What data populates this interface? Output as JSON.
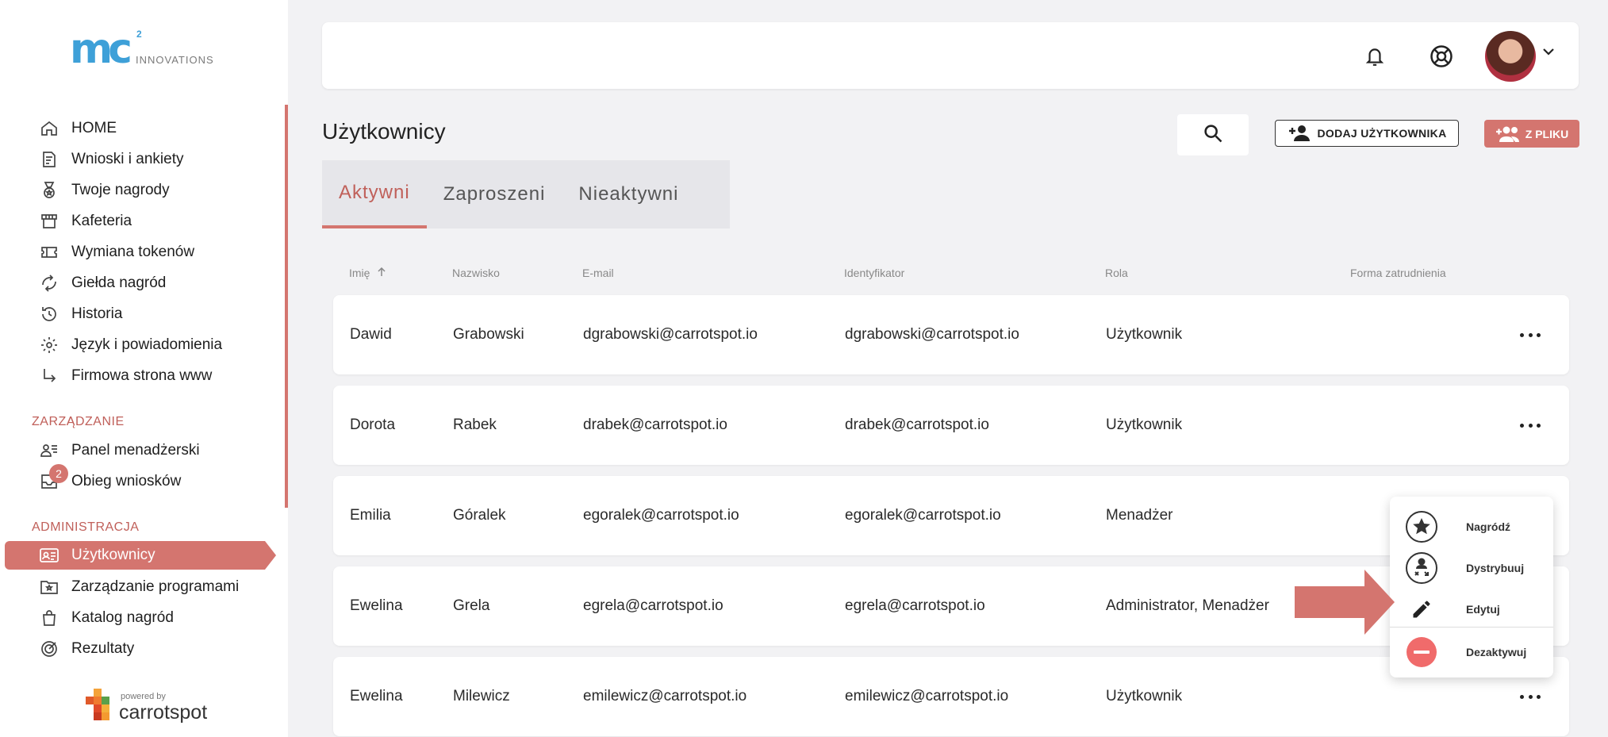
{
  "logo": {
    "mark": "mc",
    "sup": "2",
    "sub": "INNOVATIONS"
  },
  "sidebar": {
    "items": [
      {
        "label": "HOME",
        "icon": "home-icon"
      },
      {
        "label": "Wnioski i ankiety",
        "icon": "form-icon"
      },
      {
        "label": "Twoje nagrody",
        "icon": "medal-icon"
      },
      {
        "label": "Kafeteria",
        "icon": "store-icon"
      },
      {
        "label": "Wymiana tokenów",
        "icon": "ticket-icon"
      },
      {
        "label": "Giełda nagród",
        "icon": "exchange-icon"
      },
      {
        "label": "Historia",
        "icon": "history-icon"
      },
      {
        "label": "Język i powiadomienia",
        "icon": "gear-icon"
      },
      {
        "label": "Firmowa strona www",
        "icon": "return-arrow-icon"
      }
    ],
    "section_management": "ZARZĄDZANIE",
    "management_items": [
      {
        "label": "Panel menadżerski",
        "icon": "manager-icon"
      },
      {
        "label": "Obieg wniosków",
        "icon": "inbox-icon",
        "badge": "2"
      }
    ],
    "section_admin": "ADMINISTRACJA",
    "admin_items": [
      {
        "label": "Użytkownicy",
        "icon": "id-card-icon"
      },
      {
        "label": "Zarządzanie programami",
        "icon": "folder-star-icon"
      },
      {
        "label": "Katalog nagród",
        "icon": "bag-icon"
      },
      {
        "label": "Rezultaty",
        "icon": "target-icon"
      }
    ],
    "powered_by": "powered by",
    "brand": "carrotspot"
  },
  "header": {
    "title": "Użytkownicy",
    "add_user": "DODAJ UŻYTKOWNIKA",
    "from_file": "Z PLIKU"
  },
  "tabs": [
    {
      "label": "Aktywni",
      "active": true
    },
    {
      "label": "Zaproszeni",
      "active": false
    },
    {
      "label": "Nieaktywni",
      "active": false
    }
  ],
  "table": {
    "columns": [
      "Imię",
      "Nazwisko",
      "E-mail",
      "Identyfikator",
      "Rola",
      "Forma zatrudnienia"
    ],
    "rows": [
      [
        "Dawid",
        "Grabowski",
        "dgrabowski@carrotspot.io",
        "dgrabowski@carrotspot.io",
        "Użytkownik"
      ],
      [
        "Dorota",
        "Rabek",
        "drabek@carrotspot.io",
        "drabek@carrotspot.io",
        "Użytkownik"
      ],
      [
        "Emilia",
        "Góralek",
        "egoralek@carrotspot.io",
        "egoralek@carrotspot.io",
        "Menadżer"
      ],
      [
        "Ewelina",
        "Grela",
        "egrela@carrotspot.io",
        "egrela@carrotspot.io",
        "Administrator, Menadżer"
      ],
      [
        "Ewelina",
        "Milewicz",
        "emilewicz@carrotspot.io",
        "emilewicz@carrotspot.io",
        "Użytkownik"
      ]
    ]
  },
  "menu": {
    "items": [
      {
        "label": "Nagródź",
        "icon": "star-circle-icon"
      },
      {
        "label": "Dystrybuuj",
        "icon": "distribute-icon"
      },
      {
        "label": "Edytuj",
        "icon": "pencil-icon"
      },
      {
        "label": "Dezaktywuj",
        "icon": "minus-circle-icon"
      }
    ]
  },
  "colors": {
    "accent": "#d4756f",
    "logo": "#3ea0d8",
    "danger": "#f06b6b"
  }
}
